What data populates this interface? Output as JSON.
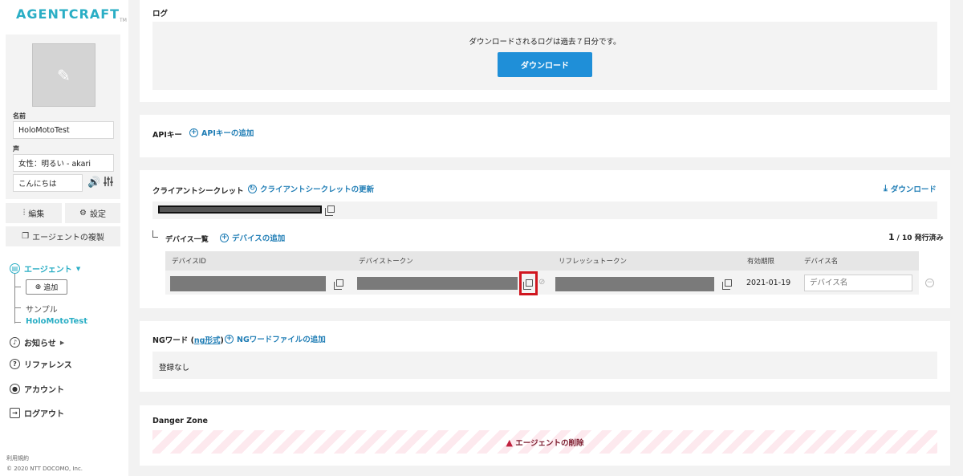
{
  "app": {
    "logo": "AGENTCRAFT",
    "logo_tm": "TM"
  },
  "sidebar": {
    "name_label": "名前",
    "name_value": "HoloMotoTest",
    "voice_label": "声",
    "voice_value": "女性：明るい - akari",
    "greeting_value": "こんにちは",
    "edit_label": "編集",
    "settings_label": "設定",
    "duplicate_label": "エージェントの複製",
    "nav": {
      "agent": "エージェント",
      "add": "追加",
      "sample": "サンプル",
      "current": "HoloMotoTest",
      "news": "お知らせ",
      "reference": "リファレンス",
      "account": "アカウント",
      "logout": "ログアウト"
    },
    "footer_terms": "利用規約",
    "footer_copyright": "© 2020 NTT DOCOMO, Inc."
  },
  "log": {
    "title": "ログ",
    "message": "ダウンロードされるログは過去７日分です。",
    "download_button": "ダウンロード"
  },
  "api": {
    "title": "APIキー",
    "add_link": "APIキーの追加"
  },
  "client": {
    "title": "クライアントシークレット",
    "refresh_link": "クライアントシークレットの更新",
    "download_link": "ダウンロード"
  },
  "devices": {
    "title": "デバイス一覧",
    "add_link": "デバイスの追加",
    "count_num": "1",
    "count_text": "/ 10 発行済み",
    "columns": [
      "デバイスID",
      "デバイストークン",
      "リフレッシュトークン",
      "有効期限",
      "デバイス名"
    ],
    "row": {
      "expiry": "2021-01-19",
      "name_placeholder": "デバイス名"
    }
  },
  "ng": {
    "title": "NGワード",
    "format_prefix": "(",
    "format_link": "ng形式",
    "format_suffix": ")",
    "add_link": "NGワードファイルの追加",
    "empty": "登録なし"
  },
  "danger": {
    "title": "Danger Zone",
    "delete_label": "エージェントの削除"
  },
  "colors": {
    "accent": "#2aaec5",
    "link": "#1f7db5",
    "button": "#1f8fd8",
    "danger": "#c0223f"
  }
}
